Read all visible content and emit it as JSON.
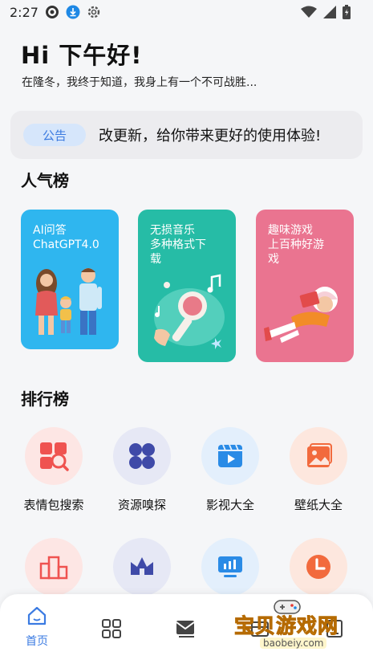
{
  "status_bar": {
    "time": "2:27"
  },
  "greeting": {
    "title": "Hi 下午好!",
    "subtitle": "在隆冬，我终于知道，我身上有一个不可战胜..."
  },
  "notice": {
    "badge": "公告",
    "text": "改更新，给你带来更好的使用体验!"
  },
  "popular": {
    "title": "人气榜",
    "cards": [
      {
        "line1": "AI问答",
        "line2": "ChatGPT4.0",
        "line3": "",
        "color": "#2fb6ef"
      },
      {
        "line1": "无损音乐",
        "line2": "多种格式下",
        "line3": "载",
        "color": "#26bca6"
      },
      {
        "line1": "趣味游戏",
        "line2": "上百种好游",
        "line3": "戏",
        "color": "#ea7490"
      }
    ]
  },
  "ranking": {
    "title": "排行榜",
    "items": [
      {
        "label": "表情包搜索",
        "icon": "image-search-icon",
        "bg": "#fde6e4"
      },
      {
        "label": "资源嗅探",
        "icon": "four-petal-icon",
        "bg": "#e6e8f5"
      },
      {
        "label": "影视大全",
        "icon": "video-player-icon",
        "bg": "#e3effc"
      },
      {
        "label": "壁纸大全",
        "icon": "picture-icon",
        "bg": "#fde7de"
      },
      {
        "label": "",
        "icon": "podium-icon",
        "bg": "#fde6e4"
      },
      {
        "label": "",
        "icon": "crown-icon",
        "bg": "#e6e8f5"
      },
      {
        "label": "",
        "icon": "chart-screen-icon",
        "bg": "#e3effc"
      },
      {
        "label": "",
        "icon": "clock-icon",
        "bg": "#fde7de"
      }
    ]
  },
  "bottom_nav": {
    "items": [
      {
        "label": "首页",
        "icon": "home-icon",
        "active": true
      },
      {
        "label": "",
        "icon": "grid-icon"
      },
      {
        "label": "",
        "icon": "mail-icon"
      },
      {
        "label": "",
        "icon": "box-icon"
      },
      {
        "label": "",
        "icon": "profile-icon"
      }
    ],
    "accent": "#3b7be2"
  },
  "watermark": {
    "text": "宝贝游戏网",
    "url": "baobeiy.com"
  }
}
